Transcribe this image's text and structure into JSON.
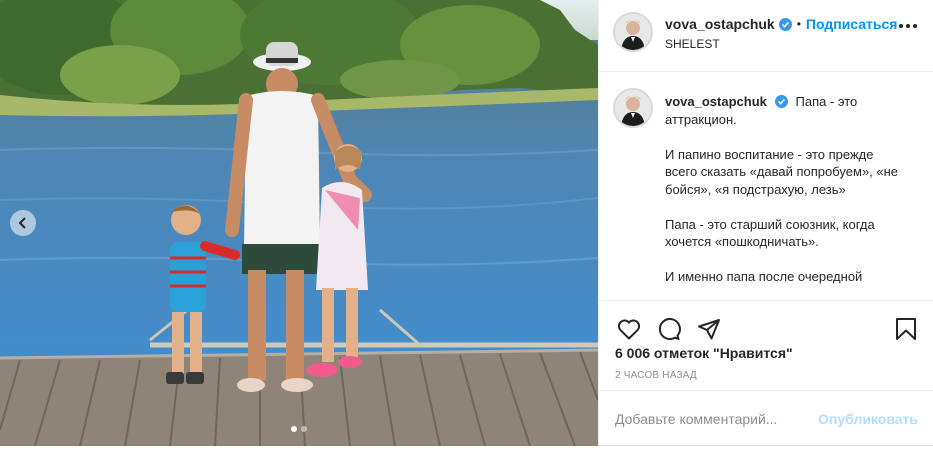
{
  "post": {
    "username": "vova_ostapchuk",
    "follow_label": "Подписаться",
    "separator": "•",
    "location": "SHELEST",
    "caption_lines": [
      "Папа - это аттракцион.",
      "И папино воспитание - это прежде всего сказать «давай попробуем», «не бойся», «я подстрахую, лезь»",
      "Папа - это старший союзник, когда хочется «пошкодничать».",
      "И именно папа после очередной"
    ],
    "caption_first": "Папа - это аттракцион.",
    "likes_text": "6 006 отметок \"Нравится\"",
    "time_text": "2 ЧАСОВ НАЗАД",
    "comment_placeholder": "Добавьте комментарий...",
    "publish_label": "Опубликовать"
  },
  "carousel": {
    "slide_count": 2,
    "active_slide": 1
  },
  "icons": {
    "verified": "verified-badge-icon",
    "more": "more-options-icon",
    "like": "heart-icon",
    "comment": "comment-icon",
    "share": "share-icon",
    "save": "bookmark-icon",
    "prev": "chevron-left-icon"
  },
  "colors": {
    "accent": "#0095f6",
    "verified": "#3897f0",
    "muted": "#8e8e8e",
    "publish_disabled": "#b2dffc"
  }
}
